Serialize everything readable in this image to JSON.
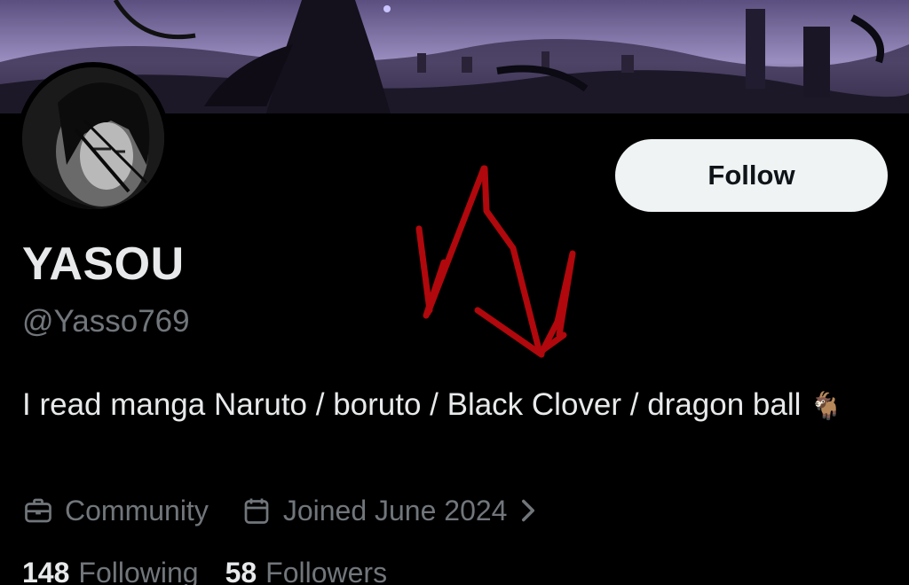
{
  "profile": {
    "display_name": "YASOU",
    "handle": "@Yasso769",
    "bio_text": "I read manga Naruto / boruto / Black Clover / dragon ball",
    "bio_emoji": "🐐",
    "follow_label": "Follow"
  },
  "meta": {
    "community_label": "Community",
    "joined_label": "Joined June 2024"
  },
  "counts": {
    "following_number": "148",
    "following_label": "Following",
    "followers_number": "58",
    "followers_label": "Followers"
  },
  "icons": {
    "community": "briefcase-icon",
    "joined": "calendar-icon",
    "chevron": "chevron-right-icon"
  },
  "colors": {
    "background": "#000000",
    "primary_text": "#e7e9ea",
    "secondary_text": "#71767b",
    "follow_button_bg": "#eff3f4",
    "scribble_red": "#b0080c"
  }
}
